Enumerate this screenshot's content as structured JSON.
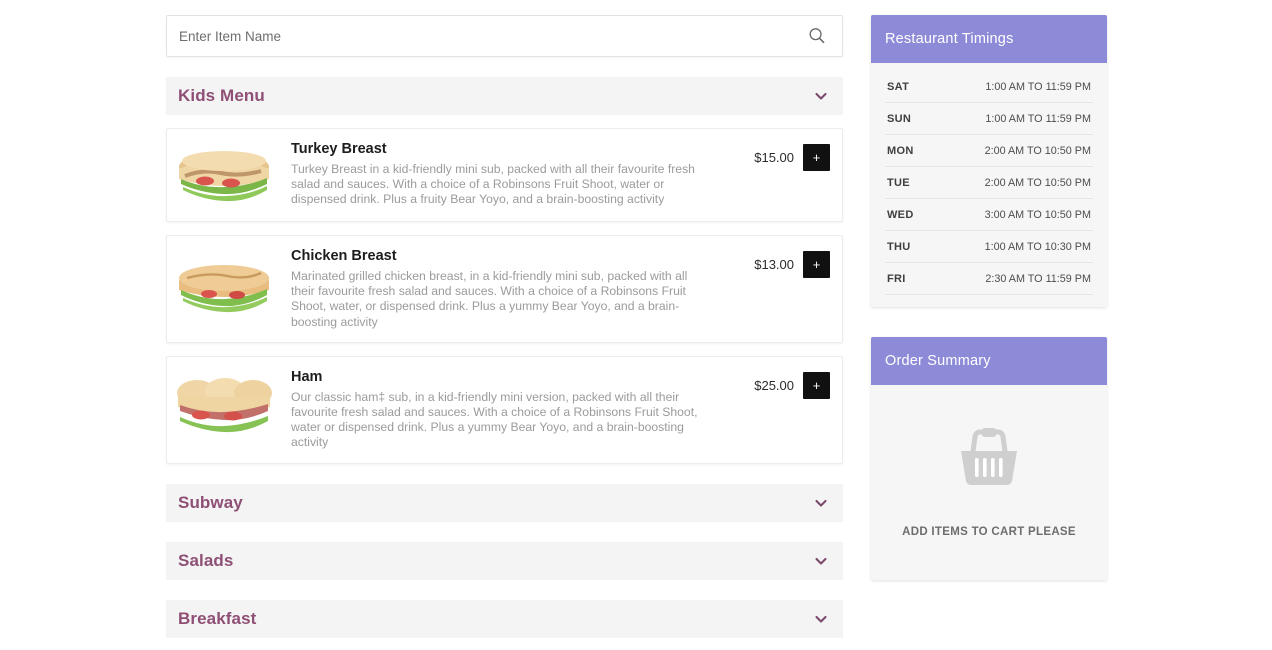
{
  "search": {
    "placeholder": "Enter Item Name",
    "value": "",
    "icon": "search-icon"
  },
  "menu": {
    "categories": [
      {
        "label": "Kids Menu",
        "expanded": true,
        "chevron_icon": "chevron-down-icon",
        "items": [
          {
            "name": "Turkey Breast",
            "description": "Turkey Breast in a kid-friendly mini sub, packed with all their favourite fresh salad and sauces. With a choice of a Robinsons Fruit Shoot, water or dispensed drink. Plus a fruity Bear Yoyo, and a brain-boosting activity",
            "price": "$15.00",
            "add_label": "+",
            "image_alt": "turkey-breast-sub"
          },
          {
            "name": "Chicken Breast",
            "description": "Marinated grilled chicken breast, in a kid-friendly mini sub, packed with all their favourite fresh salad and sauces. With a choice of a Robinsons Fruit Shoot, water, or dispensed drink. Plus a yummy Bear Yoyo, and a brain-boosting activity",
            "price": "$13.00",
            "add_label": "+",
            "image_alt": "chicken-breast-sub"
          },
          {
            "name": "Ham",
            "description": "Our classic ham‡ sub, in a kid-friendly mini version, packed with all their favourite fresh salad and sauces. With a choice of a Robinsons Fruit Shoot, water or dispensed drink. Plus a yummy Bear Yoyo, and a brain-boosting activity",
            "price": "$25.00",
            "add_label": "+",
            "image_alt": "ham-sub"
          }
        ]
      },
      {
        "label": "Subway",
        "expanded": false,
        "chevron_icon": "chevron-down-icon",
        "items": []
      },
      {
        "label": "Salads",
        "expanded": false,
        "chevron_icon": "chevron-down-icon",
        "items": []
      },
      {
        "label": "Breakfast",
        "expanded": false,
        "chevron_icon": "chevron-down-icon",
        "items": []
      }
    ]
  },
  "timings": {
    "title": "Restaurant Timings",
    "rows": [
      {
        "day": "SAT",
        "hours": "1:00 AM TO 11:59 PM"
      },
      {
        "day": "SUN",
        "hours": "1:00 AM TO 11:59 PM"
      },
      {
        "day": "MON",
        "hours": "2:00 AM TO 10:50 PM"
      },
      {
        "day": "TUE",
        "hours": "2:00 AM TO 10:50 PM"
      },
      {
        "day": "WED",
        "hours": "3:00 AM TO 10:50 PM"
      },
      {
        "day": "THU",
        "hours": "1:00 AM TO 10:30 PM"
      },
      {
        "day": "FRI",
        "hours": "2:30 AM TO 11:59 PM"
      }
    ]
  },
  "order_summary": {
    "title": "Order Summary",
    "empty_text": "ADD ITEMS TO CART PLEASE",
    "empty_icon": "shopping-basket-icon"
  },
  "colors": {
    "panel_header_purple": "#8d8bd8",
    "category_title_mauve": "#8e4f75",
    "category_bar_bg": "#f5f4f5",
    "add_button_black": "#111111",
    "page_bg": "#ffffff"
  }
}
